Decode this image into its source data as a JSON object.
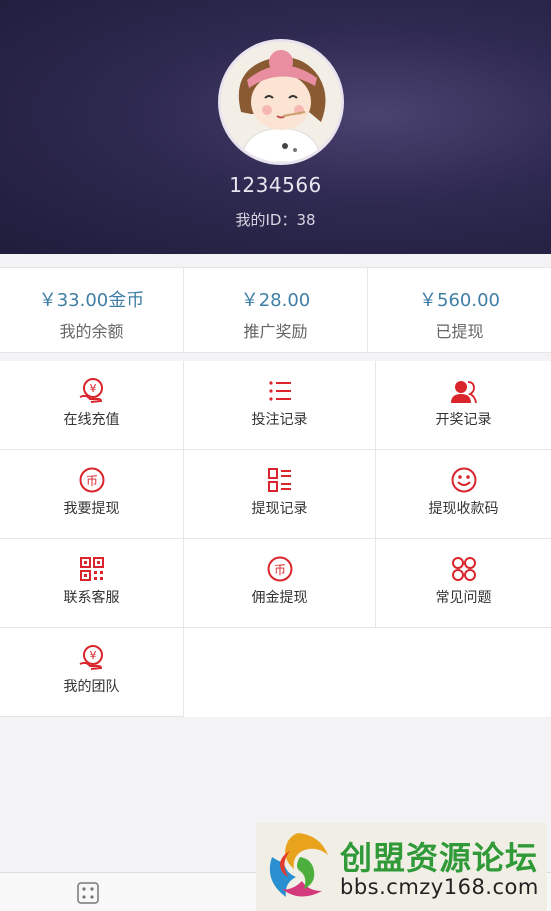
{
  "profile": {
    "username": "1234566",
    "user_id": "我的ID：38"
  },
  "stats": [
    {
      "value": "￥33.00金币",
      "label": "我的余额"
    },
    {
      "value": "￥28.00",
      "label": "推广奖励"
    },
    {
      "value": "￥560.00",
      "label": "已提现"
    }
  ],
  "menu": [
    {
      "label": "在线充值",
      "icon": "yuan-hand-icon"
    },
    {
      "label": "投注记录",
      "icon": "list-icon"
    },
    {
      "label": "开奖记录",
      "icon": "users-icon"
    },
    {
      "label": "我要提现",
      "icon": "coin-icon"
    },
    {
      "label": "提现记录",
      "icon": "list-record-icon"
    },
    {
      "label": "提现收款码",
      "icon": "smile-icon"
    },
    {
      "label": "联系客服",
      "icon": "qr-code-icon"
    },
    {
      "label": "佣金提现",
      "icon": "coin-icon"
    },
    {
      "label": "常见问题",
      "icon": "grid-circles-icon"
    },
    {
      "label": "我的团队",
      "icon": "yuan-hand-icon"
    }
  ],
  "watermark": {
    "title": "创盟资源论坛",
    "url": "bbs.cmzy168.com"
  },
  "colors": {
    "accent": "#d9252b",
    "stat_value": "#3f7fa6",
    "header_bg": "#2e2950"
  }
}
